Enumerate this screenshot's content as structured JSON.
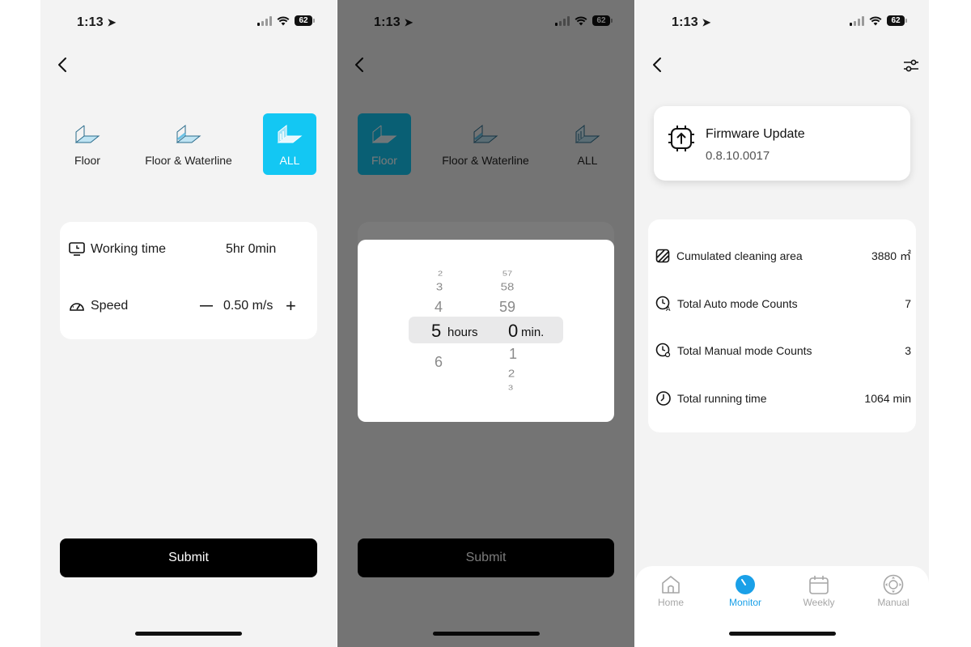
{
  "status": {
    "time": "1:13",
    "battery": "62"
  },
  "mode_selector": {
    "items": [
      {
        "label": "Floor"
      },
      {
        "label": "Floor & Waterline"
      },
      {
        "label": "ALL"
      }
    ]
  },
  "settings_card": {
    "working_time_label": "Working time",
    "working_time_value": "5hr 0min",
    "speed_label": "Speed",
    "speed_value": "0.50 m/s",
    "minus": "—",
    "plus": "+"
  },
  "submit_label": "Submit",
  "time_picker": {
    "hours": [
      "2",
      "3",
      "4",
      "5",
      "6"
    ],
    "minutes": [
      "57",
      "58",
      "59",
      "0",
      "1",
      "2",
      "3"
    ],
    "selected_hours": "5",
    "selected_minutes": "0",
    "hours_unit": "hours",
    "minutes_unit": "min."
  },
  "firmware": {
    "title": "Firmware Update",
    "version": "0.8.10.0017"
  },
  "stats": [
    {
      "label": "Cumulated cleaning area",
      "value": "3880 ㎡"
    },
    {
      "label": "Total Auto mode Counts",
      "value": "7"
    },
    {
      "label": "Total Manual mode Counts",
      "value": "3"
    },
    {
      "label": "Total running time",
      "value": "1064 min"
    }
  ],
  "tabs": [
    {
      "label": "Home"
    },
    {
      "label": "Monitor"
    },
    {
      "label": "Weekly"
    },
    {
      "label": "Manual"
    }
  ],
  "colors": {
    "accent": "#13c7f3",
    "tab_active": "#1aa0e8",
    "button": "#000000"
  }
}
